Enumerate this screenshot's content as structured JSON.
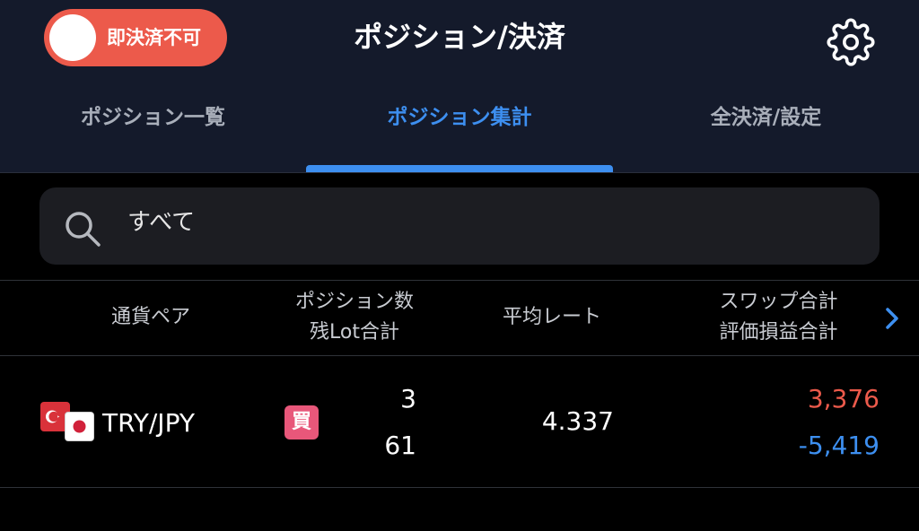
{
  "header": {
    "toggle_label": "即決済不可",
    "title": "ポジション/決済",
    "settings_icon": "gear-icon"
  },
  "tabs": [
    {
      "label": "ポジション一覧",
      "active": false
    },
    {
      "label": "ポジション集計",
      "active": true
    },
    {
      "label": "全決済/設定",
      "active": false
    }
  ],
  "search": {
    "icon": "search-icon",
    "value": "すべて"
  },
  "table": {
    "headers": {
      "pair": "通貨ペア",
      "positions_line1": "ポジション数",
      "positions_line2": "残Lot合計",
      "avg_rate": "平均レート",
      "swap_line1": "スワップ合計",
      "swap_line2": "評価損益合計"
    },
    "rows": [
      {
        "pair": "TRY/JPY",
        "side": "買",
        "position_count": "3",
        "lot_total": "61",
        "avg_rate": "4.337",
        "swap_total": "3,376",
        "pl_total": "-5,419"
      }
    ]
  },
  "colors": {
    "accent": "#3d8ff0",
    "toggle": "#ec5a4b",
    "positive": "#ec5a4b",
    "negative": "#3d8ff0",
    "buy_badge": "#e8577a",
    "header_bg": "#141a2b"
  }
}
